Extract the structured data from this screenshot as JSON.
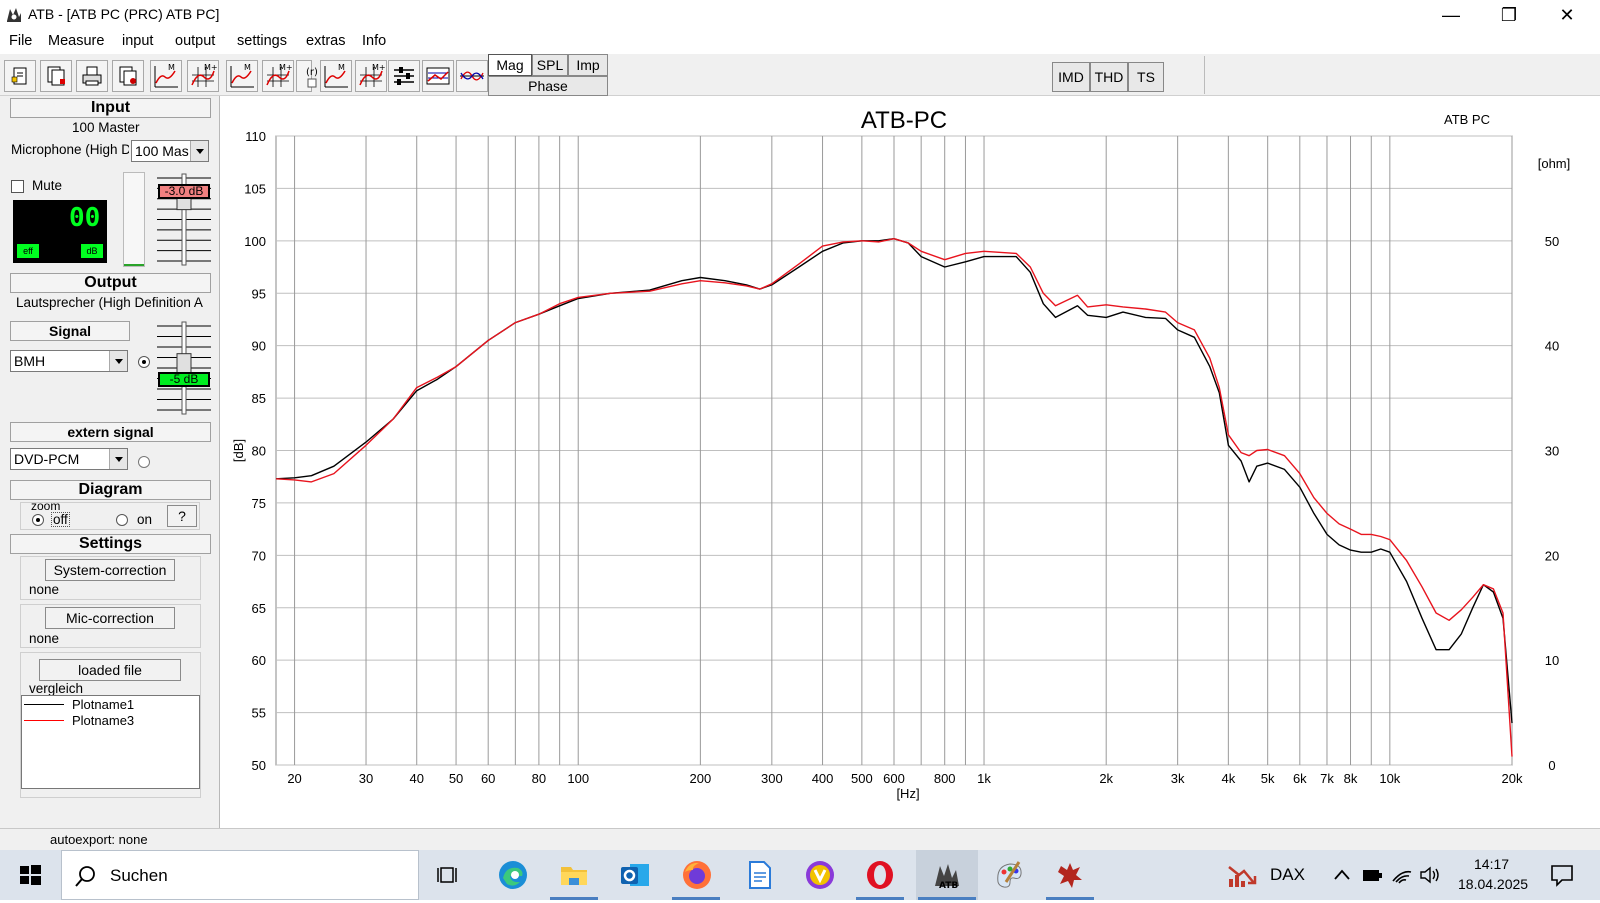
{
  "window": {
    "title": "ATB - [ATB PC (PRC)  ATB PC]",
    "controls": [
      "minimize",
      "restore",
      "close"
    ]
  },
  "menu": [
    "File",
    "Measure",
    "input",
    "output",
    "settings",
    "extras",
    "Info"
  ],
  "toolbar": {
    "mode_buttons": {
      "mag": "Mag",
      "spl": "SPL",
      "imp": "Imp",
      "phase": "Phase"
    },
    "analysis_buttons": {
      "imd": "IMD",
      "thd": "THD",
      "ts": "TS"
    },
    "icons": [
      "new-file-icon",
      "open-file-icon",
      "print-icon",
      "export-icon",
      "measure-m-icon",
      "measure-m-plus-icon",
      "measure-m-icon",
      "measure-m-plus-icon",
      "r-icon",
      "measure-m-icon",
      "measure-m-plus-icon",
      "sliders-icon",
      "graph-settings-icon",
      "compare-curves-icon"
    ]
  },
  "left_panel": {
    "input": {
      "header": "Input",
      "device_label": "100 Master",
      "microphone_label": "Microphone (High D",
      "microphone_select": "100 Mas",
      "mute_label": "Mute",
      "mute_checked": false,
      "level_display": "00",
      "led_eff": "eff",
      "led_db": "dB",
      "gain_value": "-3.0 dB",
      "gain_level": 0.78
    },
    "output": {
      "header": "Output",
      "device_label": "Lautsprecher (High Definition A",
      "signal_header": "Signal",
      "signal_select": "BMH",
      "gain_value": "-5 dB",
      "gain_level": 0.56
    },
    "extern_signal": {
      "header": "extern signal",
      "select": "DVD-PCM"
    },
    "diagram": {
      "header": "Diagram",
      "zoom_label": "zoom",
      "off_label": "off",
      "on_label": "on",
      "help_label": "?",
      "zoom": "off"
    },
    "settings": {
      "header": "Settings",
      "system_correction_button": "System-correction",
      "system_correction_value": "none",
      "mic_correction_button": "Mic-correction",
      "mic_correction_value": "none",
      "loaded_file_button": "loaded file",
      "loaded_file_value": "vergleich",
      "legend": [
        {
          "name": "Plotname1",
          "color": "#000000"
        },
        {
          "name": "Plotname3",
          "color": "#ff0000"
        }
      ]
    }
  },
  "chart_data": {
    "type": "line",
    "title": "ATB-PC",
    "corner_label": "ATB PC",
    "xlabel": "[Hz]",
    "ylabel": "[dB]",
    "y2label": "[ohm]",
    "xscale": "log",
    "xlim": [
      18,
      20000
    ],
    "ylim": [
      50,
      110
    ],
    "y2lim": [
      0,
      60
    ],
    "grid": true,
    "xticks": [
      {
        "v": 20,
        "t": "20"
      },
      {
        "v": 30,
        "t": "30"
      },
      {
        "v": 40,
        "t": "40"
      },
      {
        "v": 50,
        "t": "50"
      },
      {
        "v": 60,
        "t": "60"
      },
      {
        "v": 80,
        "t": "80"
      },
      {
        "v": 100,
        "t": "100"
      },
      {
        "v": 200,
        "t": "200"
      },
      {
        "v": 300,
        "t": "300"
      },
      {
        "v": 400,
        "t": "400"
      },
      {
        "v": 500,
        "t": "500"
      },
      {
        "v": 600,
        "t": "600"
      },
      {
        "v": 800,
        "t": "800"
      },
      {
        "v": 1000,
        "t": "1k"
      },
      {
        "v": 2000,
        "t": "2k"
      },
      {
        "v": 3000,
        "t": "3k"
      },
      {
        "v": 4000,
        "t": "4k"
      },
      {
        "v": 5000,
        "t": "5k"
      },
      {
        "v": 6000,
        "t": "6k"
      },
      {
        "v": 7000,
        "t": "7k"
      },
      {
        "v": 8000,
        "t": "8k"
      },
      {
        "v": 10000,
        "t": "10k"
      },
      {
        "v": 20000,
        "t": "20k"
      }
    ],
    "minor_gridlines": [
      70,
      90,
      700,
      900,
      9000
    ],
    "yticks": [
      50,
      55,
      60,
      65,
      70,
      75,
      80,
      85,
      90,
      95,
      100,
      105,
      110
    ],
    "y2ticks": [
      0,
      10,
      20,
      30,
      40,
      50
    ],
    "series": [
      {
        "name": "Plotname1",
        "color": "#000000",
        "points": [
          [
            18,
            77.3
          ],
          [
            20,
            77.4
          ],
          [
            22,
            77.6
          ],
          [
            25,
            78.5
          ],
          [
            30,
            80.8
          ],
          [
            35,
            83
          ],
          [
            40,
            85.7
          ],
          [
            45,
            86.8
          ],
          [
            50,
            88
          ],
          [
            60,
            90.5
          ],
          [
            70,
            92.2
          ],
          [
            80,
            93
          ],
          [
            90,
            93.8
          ],
          [
            100,
            94.5
          ],
          [
            120,
            95
          ],
          [
            150,
            95.3
          ],
          [
            180,
            96.2
          ],
          [
            200,
            96.5
          ],
          [
            230,
            96.2
          ],
          [
            260,
            95.8
          ],
          [
            280,
            95.4
          ],
          [
            300,
            95.8
          ],
          [
            350,
            97.5
          ],
          [
            400,
            99
          ],
          [
            450,
            99.8
          ],
          [
            500,
            100
          ],
          [
            550,
            100
          ],
          [
            600,
            100.2
          ],
          [
            650,
            99.8
          ],
          [
            700,
            98.5
          ],
          [
            800,
            97.5
          ],
          [
            900,
            98
          ],
          [
            1000,
            98.5
          ],
          [
            1200,
            98.5
          ],
          [
            1300,
            97
          ],
          [
            1400,
            94
          ],
          [
            1500,
            92.7
          ],
          [
            1700,
            93.8
          ],
          [
            1800,
            92.9
          ],
          [
            2000,
            92.7
          ],
          [
            2200,
            93.2
          ],
          [
            2500,
            92.7
          ],
          [
            2800,
            92.6
          ],
          [
            3000,
            91.5
          ],
          [
            3300,
            90.8
          ],
          [
            3600,
            88
          ],
          [
            3800,
            85.5
          ],
          [
            4000,
            80.5
          ],
          [
            4300,
            79
          ],
          [
            4500,
            77
          ],
          [
            4700,
            78.5
          ],
          [
            5000,
            78.8
          ],
          [
            5500,
            78.2
          ],
          [
            6000,
            76.5
          ],
          [
            6500,
            74
          ],
          [
            7000,
            72
          ],
          [
            7500,
            71
          ],
          [
            8000,
            70.5
          ],
          [
            8500,
            70.3
          ],
          [
            9000,
            70.3
          ],
          [
            9500,
            70.6
          ],
          [
            10000,
            70.3
          ],
          [
            11000,
            67.5
          ],
          [
            12000,
            64
          ],
          [
            13000,
            61
          ],
          [
            14000,
            61
          ],
          [
            15000,
            62.5
          ],
          [
            16000,
            65
          ],
          [
            17000,
            67.2
          ],
          [
            18000,
            66.5
          ],
          [
            19000,
            64
          ],
          [
            20000,
            54
          ]
        ]
      },
      {
        "name": "Plotname3",
        "color": "#e8141e",
        "points": [
          [
            18,
            77.3
          ],
          [
            20,
            77.2
          ],
          [
            22,
            77
          ],
          [
            25,
            77.8
          ],
          [
            30,
            80.5
          ],
          [
            35,
            83
          ],
          [
            40,
            86
          ],
          [
            45,
            87
          ],
          [
            50,
            88
          ],
          [
            60,
            90.5
          ],
          [
            70,
            92.2
          ],
          [
            80,
            93
          ],
          [
            90,
            94
          ],
          [
            100,
            94.6
          ],
          [
            120,
            95
          ],
          [
            150,
            95.2
          ],
          [
            180,
            95.9
          ],
          [
            200,
            96.2
          ],
          [
            230,
            96
          ],
          [
            260,
            95.7
          ],
          [
            280,
            95.4
          ],
          [
            300,
            95.9
          ],
          [
            350,
            97.8
          ],
          [
            400,
            99.5
          ],
          [
            450,
            99.9
          ],
          [
            500,
            100
          ],
          [
            550,
            99.9
          ],
          [
            600,
            100.2
          ],
          [
            650,
            99.8
          ],
          [
            700,
            99
          ],
          [
            800,
            98.2
          ],
          [
            900,
            98.8
          ],
          [
            1000,
            99
          ],
          [
            1200,
            98.8
          ],
          [
            1300,
            97.5
          ],
          [
            1400,
            95
          ],
          [
            1500,
            93.8
          ],
          [
            1700,
            94.8
          ],
          [
            1800,
            93.7
          ],
          [
            2000,
            93.9
          ],
          [
            2200,
            93.7
          ],
          [
            2500,
            93.5
          ],
          [
            2800,
            93.2
          ],
          [
            3000,
            92.2
          ],
          [
            3300,
            91.5
          ],
          [
            3600,
            88.8
          ],
          [
            3800,
            86
          ],
          [
            4000,
            81.5
          ],
          [
            4300,
            79.8
          ],
          [
            4500,
            79.5
          ],
          [
            4700,
            80
          ],
          [
            5000,
            80.1
          ],
          [
            5500,
            79.5
          ],
          [
            6000,
            77.8
          ],
          [
            6500,
            75.5
          ],
          [
            7000,
            74
          ],
          [
            7500,
            73
          ],
          [
            8000,
            72.5
          ],
          [
            8500,
            72
          ],
          [
            9000,
            72
          ],
          [
            9500,
            71.8
          ],
          [
            10000,
            71.5
          ],
          [
            11000,
            69.5
          ],
          [
            12000,
            67
          ],
          [
            13000,
            64.5
          ],
          [
            14000,
            63.8
          ],
          [
            15000,
            64.8
          ],
          [
            16000,
            66
          ],
          [
            17000,
            67.2
          ],
          [
            18000,
            66.8
          ],
          [
            19000,
            64.5
          ],
          [
            20000,
            50.8
          ]
        ]
      }
    ]
  },
  "statusbar": {
    "autoexport": "autoexport: none"
  },
  "taskbar": {
    "search_placeholder": "Suchen",
    "dax_label": "DAX",
    "time": "14:17",
    "date": "18.04.2025",
    "apps": [
      "task-view-icon",
      "edge-icon",
      "file-explorer-icon",
      "outlook-icon",
      "firefox-icon",
      "notepad-document-icon",
      "vpn-shield-icon",
      "opera-icon",
      "atb-app-icon",
      "paint-icon",
      "red-app-icon"
    ]
  }
}
